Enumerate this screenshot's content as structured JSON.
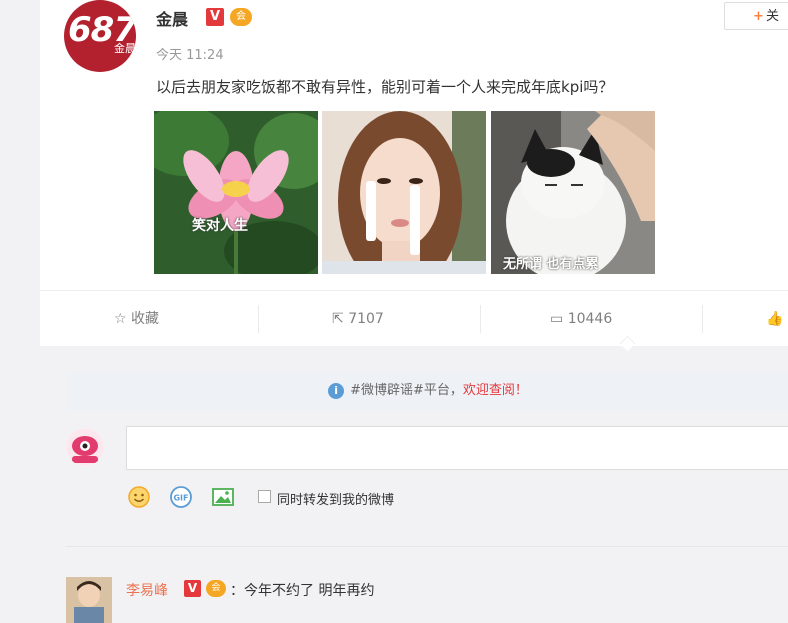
{
  "post": {
    "avatar_text": "687",
    "avatar_sub": "金晨",
    "author": "金晨",
    "verified_badge": "V",
    "member_badge": "会",
    "follow_plus": "+",
    "follow_label": "关",
    "time": "今天 11:24",
    "text": "以后去朋友家吃饭都不敢有异性，能别可着一个人来完成年底kpi吗？",
    "images": [
      {
        "icon": "lotus-image",
        "caption": "笑对人生"
      },
      {
        "icon": "woman-image",
        "caption": ""
      },
      {
        "icon": "cat-image",
        "caption": "无所谓 也有点累"
      }
    ]
  },
  "actions": {
    "favorite": {
      "icon": "star-icon",
      "label": "收藏"
    },
    "repost": {
      "icon": "repost-icon",
      "label": "7107"
    },
    "comment": {
      "icon": "comment-icon",
      "label": "10446"
    },
    "like": {
      "icon": "thumb-up-icon"
    }
  },
  "notice": {
    "text": "#微博辟谣#平台，",
    "link": "欢迎查阅！"
  },
  "composer": {
    "placeholder": "",
    "repost_checkbox_label": "同时转发到我的微博",
    "tools": [
      "emoji-icon",
      "gif-icon",
      "image-icon"
    ]
  },
  "comments": [
    {
      "author": "李易峰",
      "verified": "V",
      "member": "会",
      "text": "：今年不约了 明年再约"
    }
  ],
  "colors": {
    "accent": "#eb7350",
    "verified": "#e4393c",
    "link": "#5b9cd6"
  }
}
